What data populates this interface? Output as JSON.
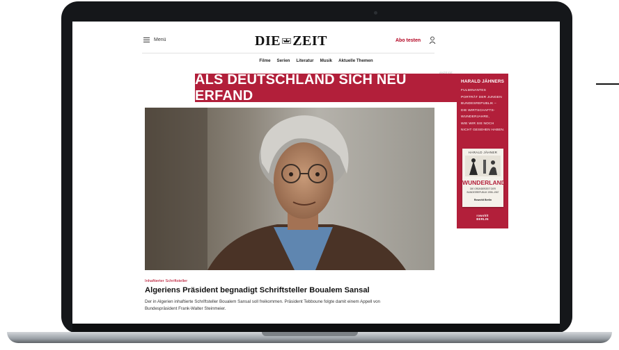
{
  "site": {
    "logo_left": "DIE",
    "logo_right": "ZEIT",
    "menu_label": "Menü",
    "subscribe_label": "Abo testen",
    "icons": {
      "menu": "hamburger-icon",
      "user": "user-icon",
      "logo_emblem": "eagle-emblem-icon"
    }
  },
  "nav": {
    "items": [
      "Filme",
      "Serien",
      "Literatur",
      "Musik",
      "Aktuelle Themen"
    ]
  },
  "ad": {
    "label": "ANZEIGE",
    "banner_text": "ALS DEUTSCHLAND SICH NEU ERFAND",
    "color": "#b21f3a",
    "sky_author": "HARALD JÄHNERS",
    "sky_lines": [
      "FULMINANTES",
      "PORTRÄT DER JUNGEN",
      "BUNDESREPUBLIK –",
      "DIE WIRTSCHAFTS-",
      "WUNDERJAHRE,",
      "WIE WIR SIE NOCH",
      "NICHT GESEHEN HABEN."
    ],
    "book": {
      "author": "HARALD JÄHNER",
      "title": "WUNDERLAND",
      "subtitle": "DIE GRÜNDERZEIT DER BUNDESREPUBLIK 1955–1967",
      "publisher_badge": "Rowohlt Berlin"
    },
    "publisher": "rowohlt BERLIN"
  },
  "article": {
    "kicker": "Inhaftierter Schriftsteller",
    "headline": "Algeriens Präsident begnadigt Schriftsteller Boualem Sansal",
    "teaser": "Der in Algerien inhaftierte Schriftsteller Boualem Sansal soll freikommen. Präsident Tebboune folgte damit einem Appell von Bundespräsident Frank-Walter Steinmeier.",
    "accent_color": "#b2001f"
  }
}
